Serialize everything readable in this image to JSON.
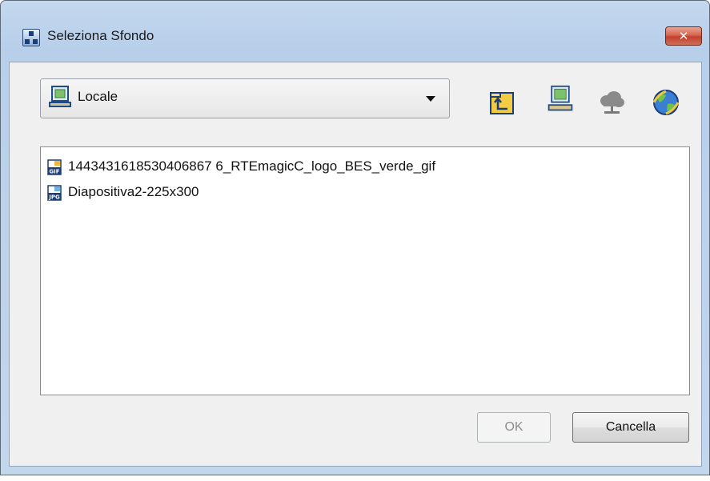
{
  "window": {
    "title": "Seleziona Sfondo",
    "close_label": "✕"
  },
  "location": {
    "selected": "Locale",
    "icon": "computer-icon"
  },
  "toolbar": [
    {
      "name": "parent-folder-icon"
    },
    {
      "name": "local-computer-icon"
    },
    {
      "name": "cloud-network-icon"
    },
    {
      "name": "internet-globe-icon"
    }
  ],
  "files": [
    {
      "name": "1443431618530406867 6_RTEmagicC_logo_BES_verde_gif",
      "type": "GIF"
    },
    {
      "name": "Diapositiva2-225x300",
      "type": "JPG"
    }
  ],
  "buttons": {
    "ok": "OK",
    "cancel": "Cancella"
  },
  "colors": {
    "frame": "#c4d8ee",
    "close": "#c9452f",
    "client": "#f0f0f0"
  }
}
